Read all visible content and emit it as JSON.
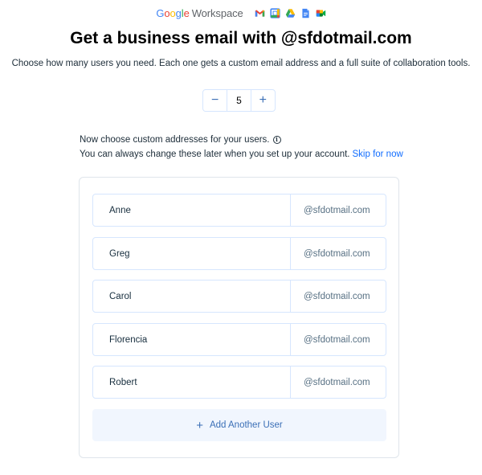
{
  "brand": {
    "google_letters": [
      {
        "ch": "G",
        "color": "#4285F4"
      },
      {
        "ch": "o",
        "color": "#EA4335"
      },
      {
        "ch": "o",
        "color": "#FBBC05"
      },
      {
        "ch": "g",
        "color": "#4285F4"
      },
      {
        "ch": "l",
        "color": "#34A853"
      },
      {
        "ch": "e",
        "color": "#EA4335"
      }
    ],
    "product": "Workspace",
    "apps": [
      "gmail-icon",
      "calendar-icon",
      "drive-icon",
      "docs-icon",
      "meet-icon"
    ]
  },
  "header": {
    "title": "Get a business email with @sfdotmail.com",
    "subtitle": "Choose how many users you need. Each one gets a custom email address and a full suite of collaboration tools."
  },
  "stepper": {
    "decrement": "−",
    "value": "5",
    "increment": "+"
  },
  "info": {
    "line1": "Now choose custom addresses for your users.",
    "line2": "You can always change these later when you set up your account.",
    "skip_link": "Skip for now"
  },
  "users": [
    {
      "name": "Anne",
      "domain": "@sfdotmail.com"
    },
    {
      "name": "Greg",
      "domain": "@sfdotmail.com"
    },
    {
      "name": "Carol",
      "domain": "@sfdotmail.com"
    },
    {
      "name": "Florencia",
      "domain": "@sfdotmail.com"
    },
    {
      "name": "Robert",
      "domain": "@sfdotmail.com"
    }
  ],
  "add_user": {
    "icon": "+",
    "label": "Add Another User"
  },
  "colors": {
    "accent": "#116dff",
    "muted_blue": "#3b6fb6",
    "border": "#d6e6fe",
    "add_bg": "#f1f6fe"
  }
}
